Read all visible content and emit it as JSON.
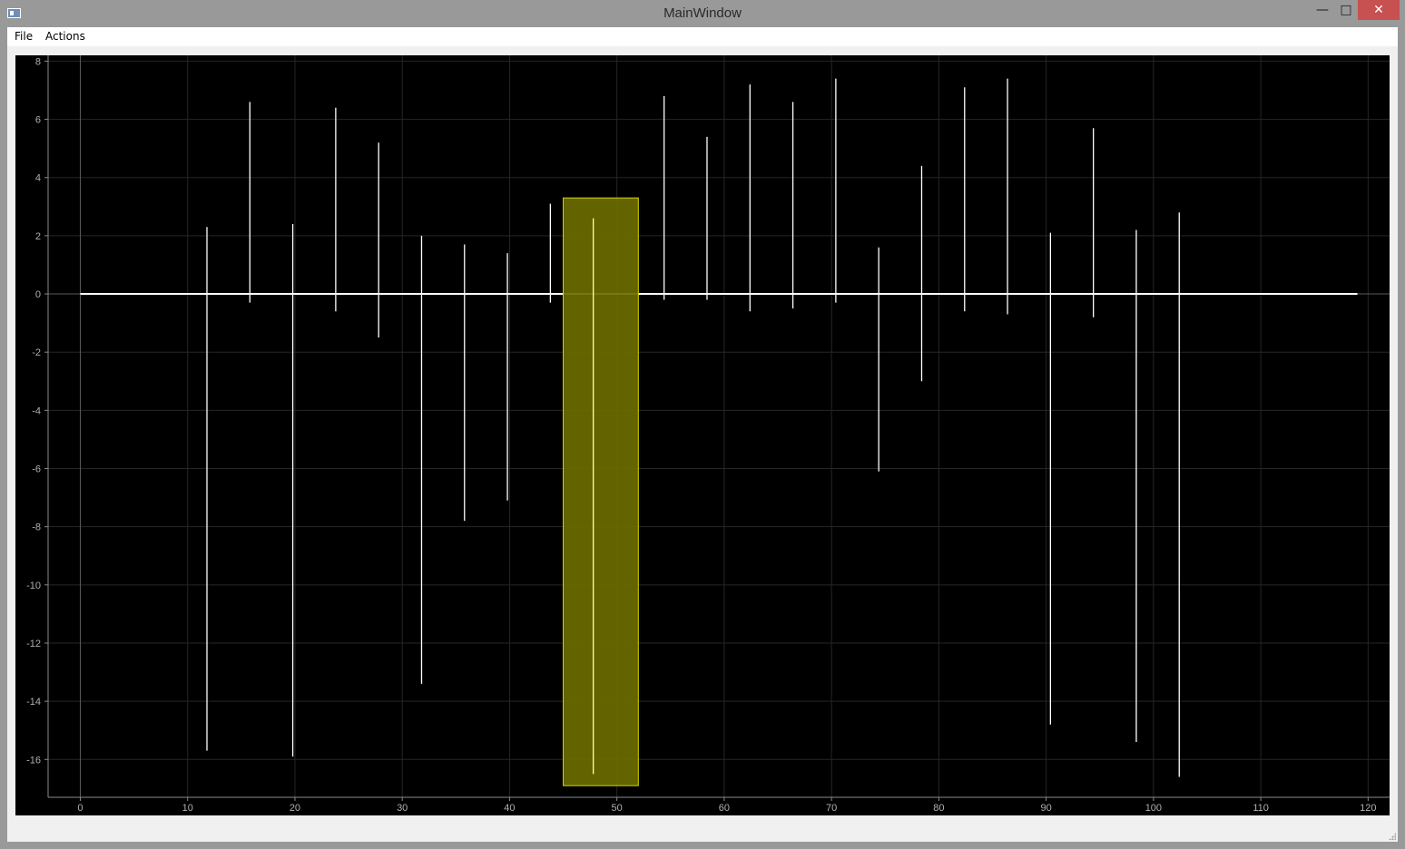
{
  "window": {
    "title": "MainWindow",
    "minimize_glyph": "—",
    "maximize_glyph": "□",
    "close_glyph": "✕",
    "icon": "app-window-icon"
  },
  "menu": {
    "items": [
      {
        "label": "File"
      },
      {
        "label": "Actions"
      }
    ]
  },
  "chart_data": {
    "type": "line",
    "title": "",
    "xlabel": "",
    "ylabel": "",
    "xlim": [
      -3,
      122
    ],
    "ylim": [
      -17.3,
      8.2
    ],
    "x_ticks": [
      0,
      10,
      20,
      30,
      40,
      50,
      60,
      70,
      80,
      90,
      100,
      110,
      120
    ],
    "y_ticks": [
      8,
      6,
      4,
      2,
      0,
      -2,
      -4,
      -6,
      -8,
      -10,
      -12,
      -14,
      -16
    ],
    "grid": true,
    "background": "#000000",
    "line_color": "#ffffff",
    "grid_color": "#262626",
    "series": [
      {
        "baseline": [
          0,
          119
        ],
        "spikes": [
          {
            "x": 11.8,
            "max": 2.3,
            "min": -15.7
          },
          {
            "x": 15.8,
            "max": 6.6,
            "min": -0.3
          },
          {
            "x": 19.8,
            "max": 2.4,
            "min": -15.9
          },
          {
            "x": 23.8,
            "max": 6.4,
            "min": -0.6
          },
          {
            "x": 27.8,
            "max": 5.2,
            "min": -1.5
          },
          {
            "x": 31.8,
            "max": 2.0,
            "min": -13.4
          },
          {
            "x": 35.8,
            "max": 1.7,
            "min": -7.8
          },
          {
            "x": 39.8,
            "max": 1.4,
            "min": -7.1
          },
          {
            "x": 43.8,
            "max": 3.1,
            "min": -0.3
          },
          {
            "x": 47.8,
            "max": 2.6,
            "min": -16.5
          },
          {
            "x": 54.4,
            "max": 6.8,
            "min": -0.2
          },
          {
            "x": 58.4,
            "max": 5.4,
            "min": -0.2
          },
          {
            "x": 62.4,
            "max": 7.2,
            "min": -0.6
          },
          {
            "x": 66.4,
            "max": 6.6,
            "min": -0.5
          },
          {
            "x": 70.4,
            "max": 7.4,
            "min": -0.3
          },
          {
            "x": 74.4,
            "max": 1.6,
            "min": -6.1
          },
          {
            "x": 78.4,
            "max": 4.4,
            "min": -3.0
          },
          {
            "x": 82.4,
            "max": 7.1,
            "min": -0.6
          },
          {
            "x": 86.4,
            "max": 7.4,
            "min": -0.7
          },
          {
            "x": 90.4,
            "max": 2.1,
            "min": -14.8
          },
          {
            "x": 94.4,
            "max": 5.7,
            "min": -0.8
          },
          {
            "x": 98.4,
            "max": 2.2,
            "min": -15.4
          },
          {
            "x": 102.4,
            "max": 2.8,
            "min": -16.6
          }
        ]
      }
    ],
    "selection": {
      "x0": 45,
      "x1": 52,
      "y0": -16.9,
      "y1": 3.3,
      "fill": "#6b6b00",
      "stroke": "#d6d600"
    }
  }
}
